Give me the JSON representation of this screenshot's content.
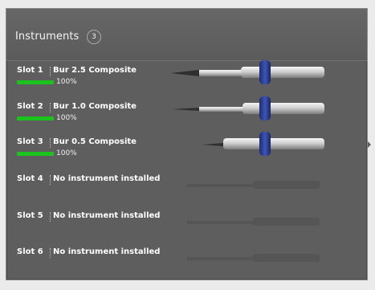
{
  "panel": {
    "title": "Instruments",
    "count": "3"
  },
  "slots": [
    {
      "label": "Slot 1",
      "tool": "Bur 2.5 Composite",
      "percent": "100%",
      "level": 1.0,
      "installed": true
    },
    {
      "label": "Slot 2",
      "tool": "Bur 1.0 Composite",
      "percent": "100%",
      "level": 1.0,
      "installed": true
    },
    {
      "label": "Slot 3",
      "tool": "Bur 0.5 Composite",
      "percent": "100%",
      "level": 1.0,
      "installed": true
    },
    {
      "label": "Slot 4",
      "tool": "No instrument installed",
      "installed": false
    },
    {
      "label": "Slot 5",
      "tool": "No instrument installed",
      "installed": false
    },
    {
      "label": "Slot 6",
      "tool": "No instrument installed",
      "installed": false
    }
  ],
  "colors": {
    "panel": "#5e5e5e",
    "wear_bar": "#1ec21e",
    "collar": "#2d3f8f"
  }
}
